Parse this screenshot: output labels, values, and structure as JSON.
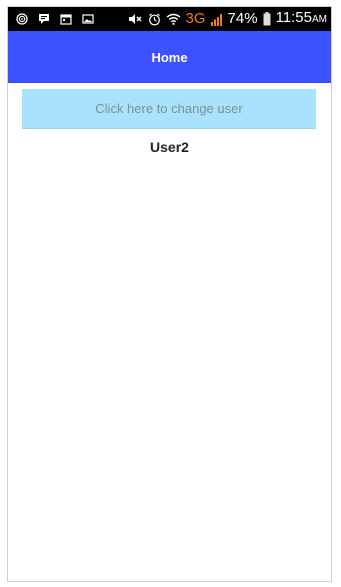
{
  "status_bar": {
    "left_icons": [
      "swirl-notification-icon",
      "chat-notification-icon",
      "calendar-notification-icon",
      "image-notification-icon"
    ],
    "right_icons": [
      "mute-icon",
      "alarm-icon",
      "wifi-icon",
      "signal-icon",
      "battery-icon"
    ],
    "network_type": "3G",
    "battery_percent": "74%",
    "time": "11:55",
    "ampm": "AM",
    "network_color": "#f07a20"
  },
  "app_bar": {
    "title": "Home",
    "color": "#3b51ff"
  },
  "main": {
    "change_user_button_label": "Click here to change user",
    "button_color": "#a9e3fb",
    "current_user": "User2"
  }
}
